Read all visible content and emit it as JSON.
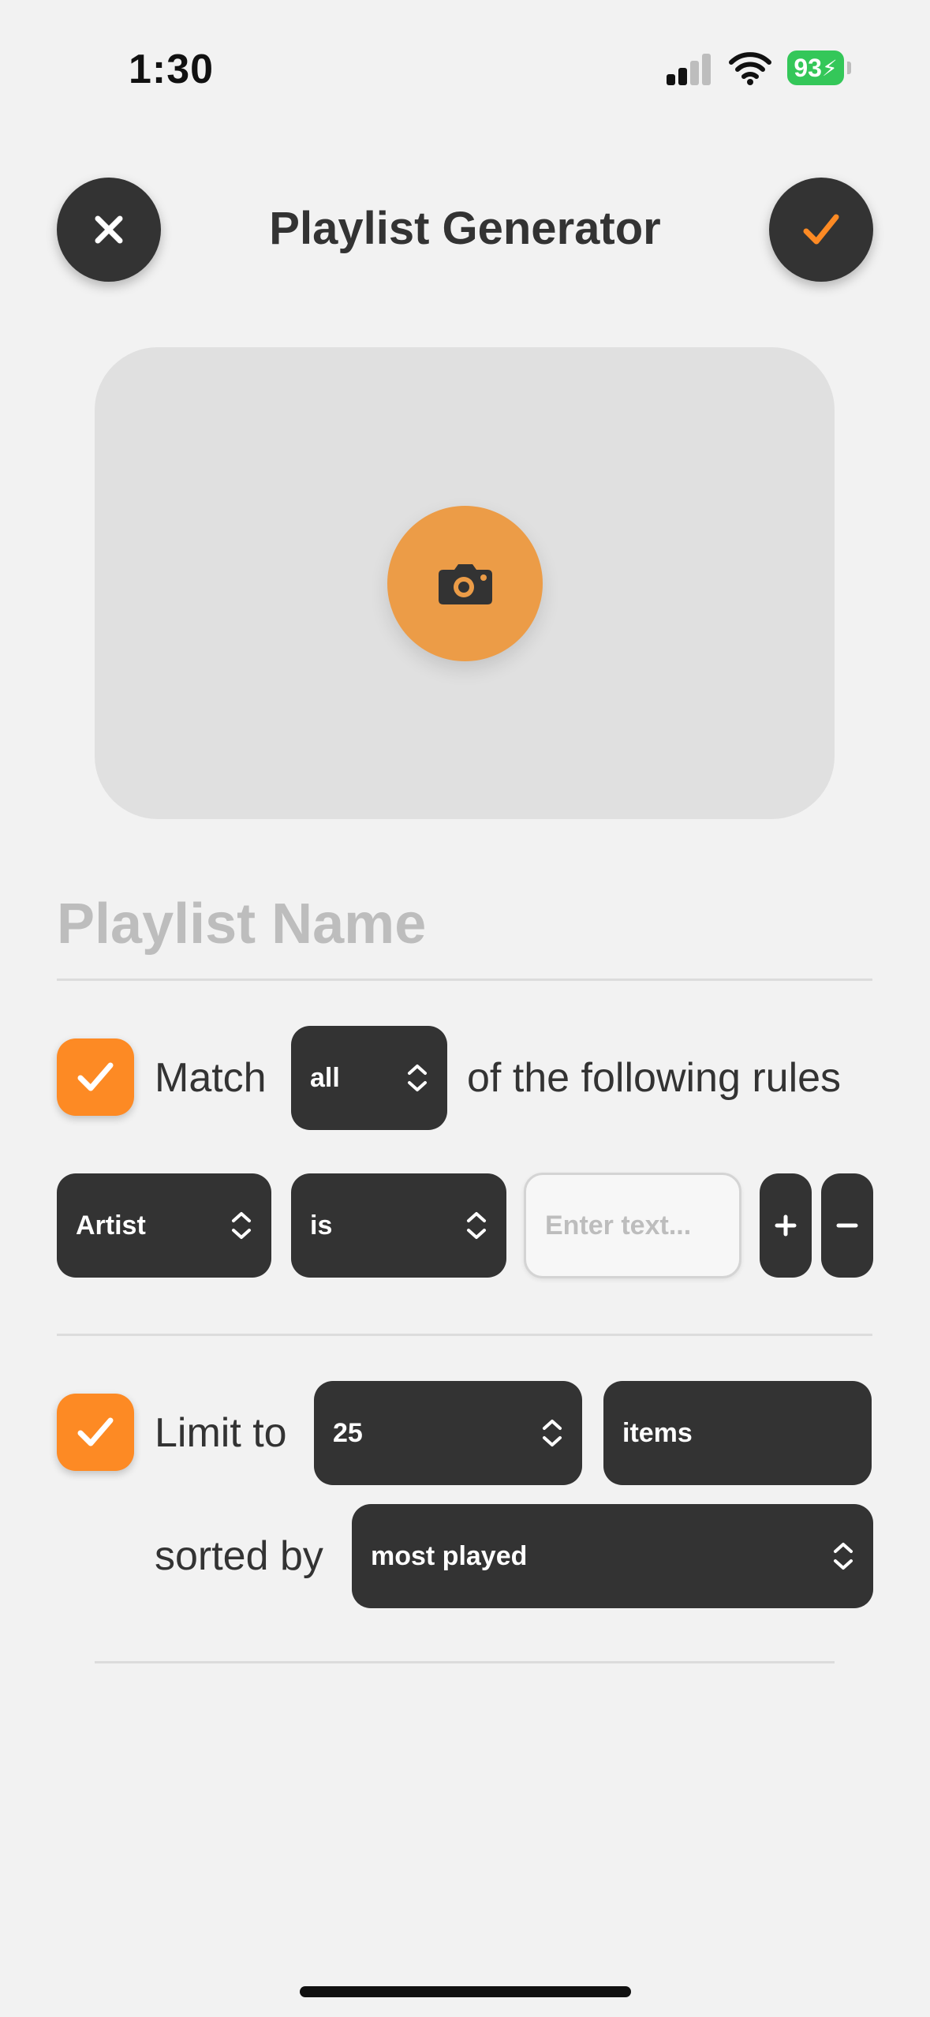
{
  "status_bar": {
    "time": "1:30",
    "battery": "93",
    "battery_color": "#34c759"
  },
  "header": {
    "title": "Playlist Generator",
    "close_icon": "xmark-icon",
    "confirm_icon": "checkmark-icon"
  },
  "artwork": {
    "icon": "camera-icon",
    "button_color": "#ec9c47"
  },
  "name_field": {
    "value": "",
    "placeholder": "Playlist Name"
  },
  "match": {
    "checked": true,
    "label": "Match",
    "selected": "all",
    "suffix": "of the following rules"
  },
  "rule": {
    "field": "Artist",
    "operator": "is",
    "value": "",
    "placeholder": "Enter text...",
    "add_label": "+",
    "remove_label": "−"
  },
  "limit": {
    "checked": true,
    "label": "Limit to",
    "count": "25",
    "unit": "items",
    "sorted_label": "sorted by",
    "sort": "most played"
  },
  "colors": {
    "accent": "#fd8a24",
    "dark": "#333333",
    "background": "#f2f2f2"
  }
}
